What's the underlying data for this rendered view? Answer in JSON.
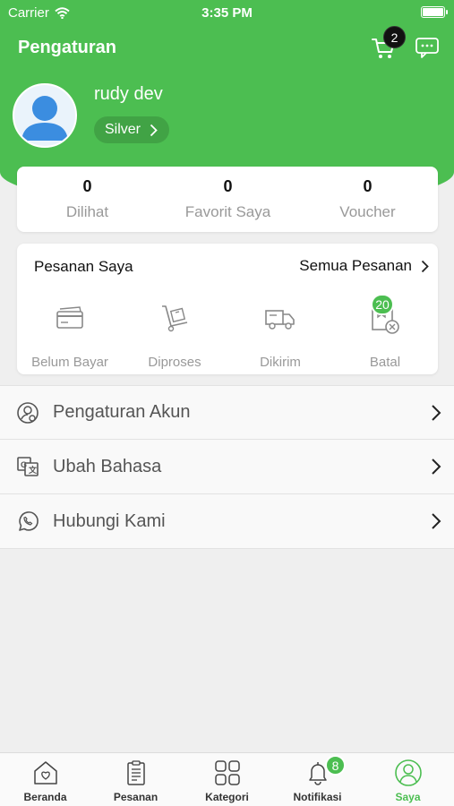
{
  "status_bar": {
    "carrier": "Carrier",
    "time": "3:35 PM"
  },
  "header": {
    "title": "Pengaturan",
    "cart_count": "2"
  },
  "profile": {
    "name": "rudy dev",
    "level": "Silver"
  },
  "stats": [
    {
      "value": "0",
      "label": "Dilihat"
    },
    {
      "value": "0",
      "label": "Favorit Saya"
    },
    {
      "value": "0",
      "label": "Voucher"
    }
  ],
  "orders": {
    "title": "Pesanan Saya",
    "all_label": "Semua Pesanan",
    "items": [
      {
        "label": "Belum Bayar",
        "icon": "card-icon"
      },
      {
        "label": "Diproses",
        "icon": "hand-truck-icon"
      },
      {
        "label": "Dikirim",
        "icon": "truck-icon"
      },
      {
        "label": "Batal",
        "icon": "cancel-box-icon",
        "badge": "20"
      }
    ]
  },
  "menu": [
    {
      "label": "Pengaturan Akun",
      "icon": "account-settings-icon"
    },
    {
      "label": "Ubah Bahasa",
      "icon": "translate-icon"
    },
    {
      "label": "Hubungi Kami",
      "icon": "whatsapp-icon"
    }
  ],
  "tabs": [
    {
      "label": "Beranda",
      "icon": "home-icon"
    },
    {
      "label": "Pesanan",
      "icon": "clipboard-icon"
    },
    {
      "label": "Kategori",
      "icon": "grid-icon"
    },
    {
      "label": "Notifikasi",
      "icon": "bell-icon",
      "badge": "8"
    },
    {
      "label": "Saya",
      "icon": "user-icon",
      "active": true
    }
  ],
  "colors": {
    "brand_green": "#4cbe51",
    "tab_active": "#4cbe51"
  }
}
